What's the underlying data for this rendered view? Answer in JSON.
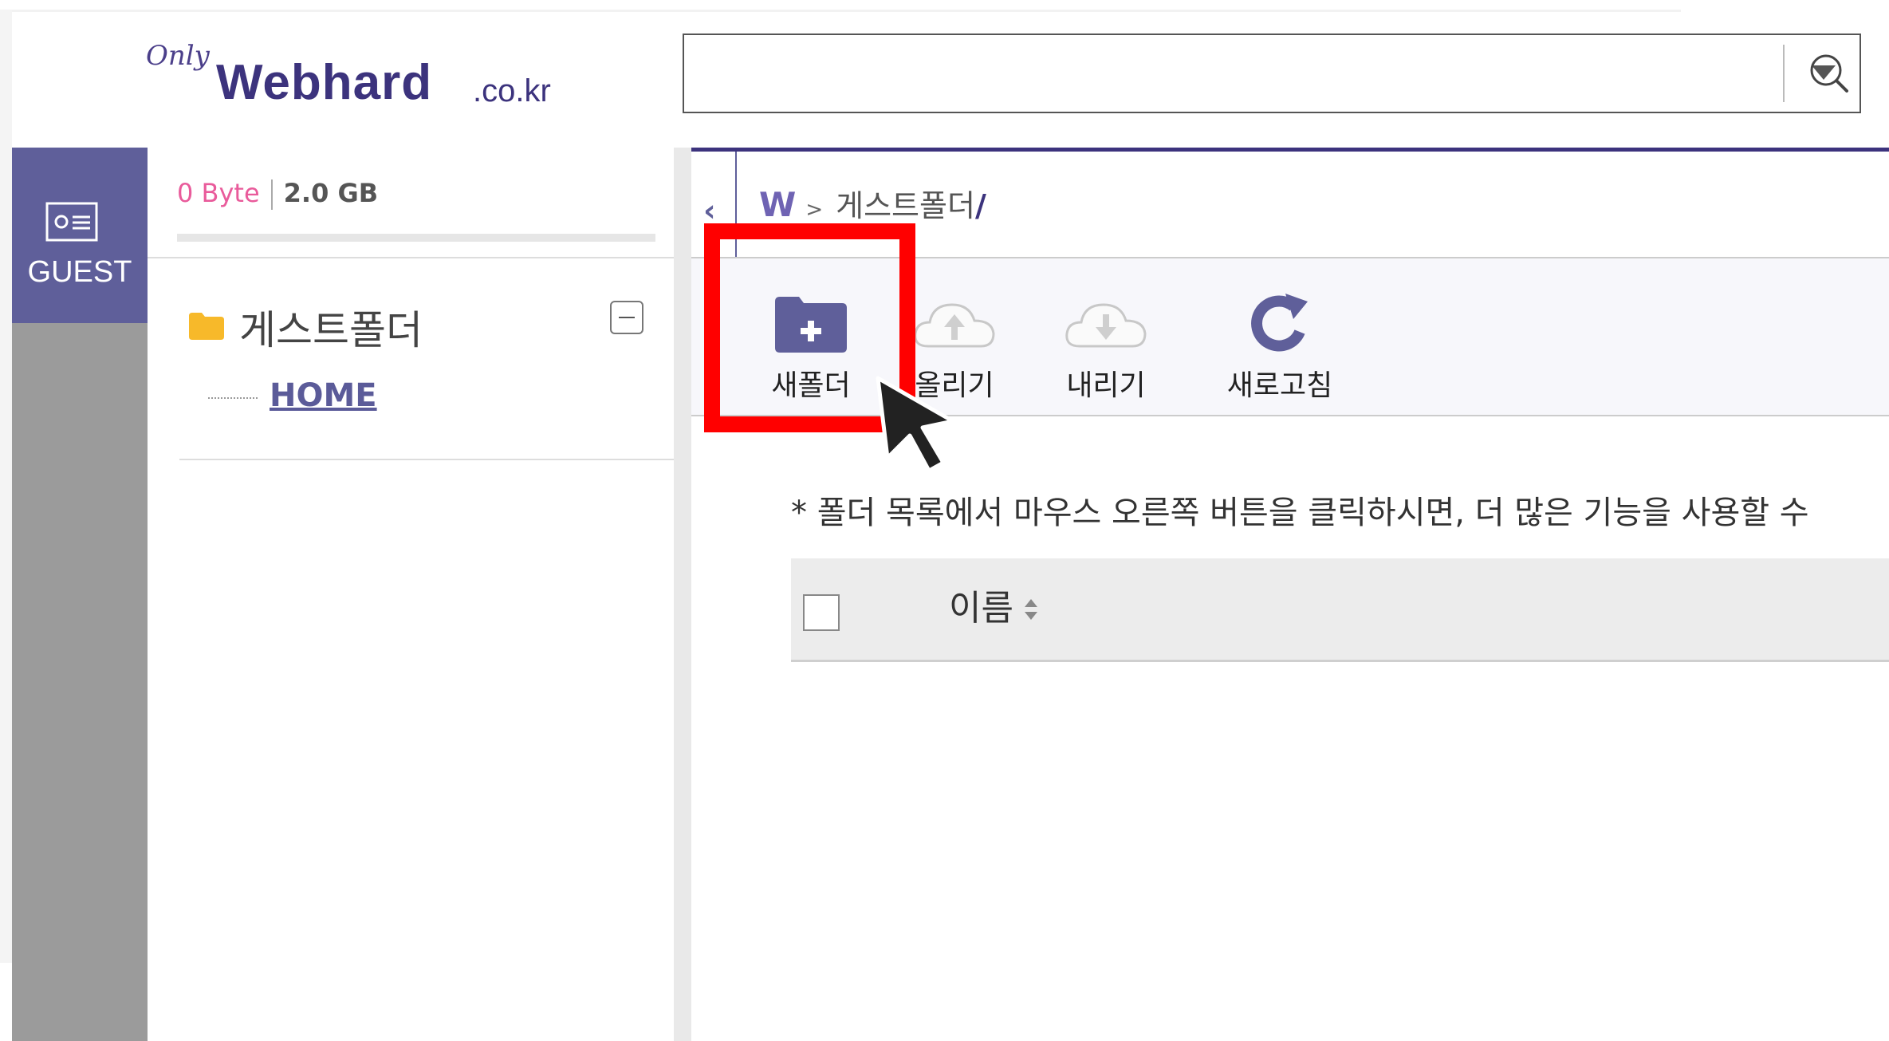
{
  "header": {
    "logo_prefix": "Only",
    "logo_main": "Webhard",
    "logo_tld": ".co.kr",
    "search": {
      "value": "",
      "placeholder": "",
      "dropdown_icon": "caret-down-icon",
      "button_icon": "search-icon"
    }
  },
  "rail": {
    "guest_label": "GUEST",
    "guest_icon": "id-card-icon"
  },
  "storage": {
    "used": "0 Byte",
    "total": "2.0 GB",
    "used_fraction": 0
  },
  "tree": {
    "root_label": "게스트폴더",
    "root_icon": "folder-icon",
    "child_label": "HOME"
  },
  "breadcrumb": {
    "home_icon": "W",
    "separator": ">",
    "path": "게스트폴더",
    "trailing": "/"
  },
  "toolbar": {
    "new_folder": "새폴더",
    "upload": "올리기",
    "download": "내리기",
    "refresh": "새로고침"
  },
  "hint": "* 폴더 목록에서 마우스 오른쪽 버튼을 클릭하시면, 더 많은 기능을 사용할 수",
  "table": {
    "name_header": "이름"
  },
  "colors": {
    "brand": "#3c337d",
    "accent": "#5f5f9a",
    "used_text": "#e95b9b",
    "highlight": "#ff0000"
  }
}
